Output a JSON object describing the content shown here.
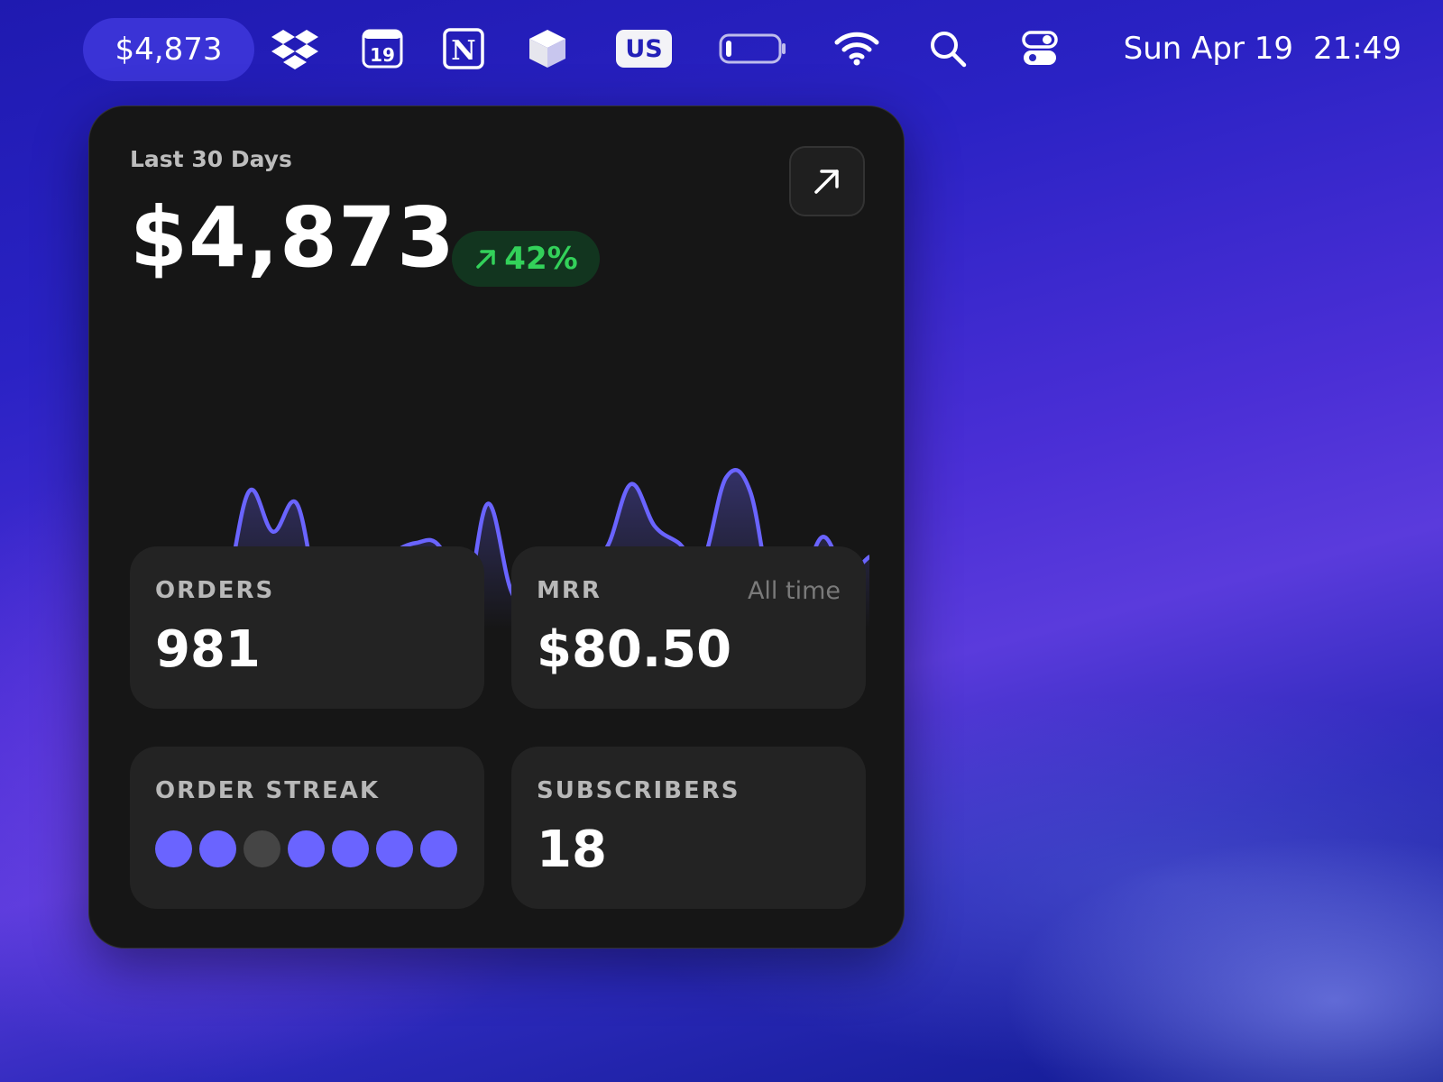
{
  "menubar": {
    "price": "$4,873",
    "calendar_day": "19",
    "input_source": "US",
    "date": "Sun Apr 19",
    "time": "21:49",
    "icons": [
      "dropbox-icon",
      "calendar-icon",
      "notion-icon",
      "cube-icon",
      "input-source-icon",
      "battery-icon",
      "wifi-icon",
      "search-icon",
      "control-center-icon"
    ]
  },
  "widget": {
    "period": "Last 30 Days",
    "revenue": "$4,873",
    "change": "42%",
    "change_direction": "up",
    "accent_color": "#6a64ff",
    "positive_color": "#33d15a",
    "cards": {
      "orders": {
        "label": "ORDERS",
        "value": "981"
      },
      "mrr": {
        "label": "MRR",
        "aside": "All time",
        "value": "$80.50"
      },
      "streak": {
        "label": "ORDER STREAK",
        "days": [
          true,
          true,
          false,
          true,
          true,
          true,
          true
        ]
      },
      "subscribers": {
        "label": "SUBSCRIBERS",
        "value": "18"
      }
    }
  },
  "chart_data": {
    "type": "area",
    "series": [
      {
        "values": [
          35,
          34,
          28,
          10,
          23,
          95,
          66,
          86,
          15,
          40,
          32,
          50,
          58,
          55,
          10,
          86,
          23,
          8,
          42,
          45,
          55,
          100,
          70,
          58,
          45,
          105,
          95,
          12,
          18,
          62,
          38,
          48
        ]
      }
    ],
    "ylim": [
      0,
      120
    ],
    "grid": false
  }
}
